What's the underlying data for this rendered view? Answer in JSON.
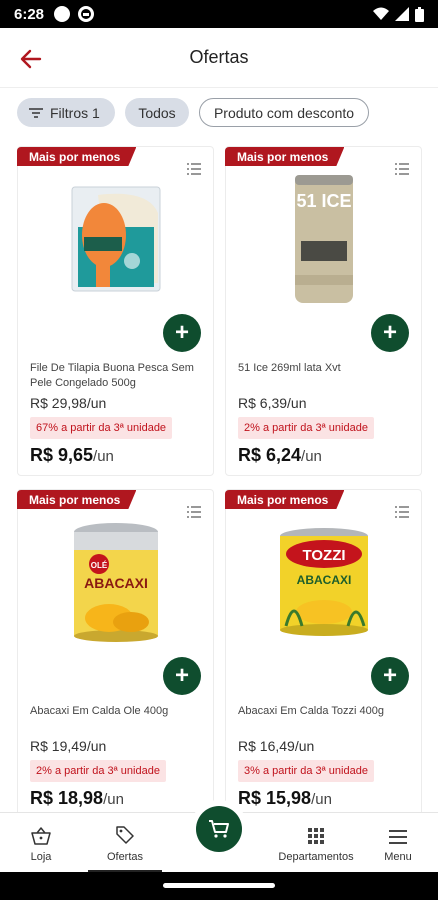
{
  "status": {
    "time": "6:28"
  },
  "header": {
    "title": "Ofertas"
  },
  "filters": {
    "filter_label": "Filtros 1",
    "all_label": "Todos",
    "discount_label": "Produto com desconto"
  },
  "products": [
    {
      "badge": "Mais por menos",
      "name": "File De Tilapia Buona Pesca Sem Pele Congelado 500g",
      "old_price": "R$ 29,98/un",
      "promo": "67% a partir da 3ª unidade",
      "price": "R$ 9,65",
      "unit": "/un"
    },
    {
      "badge": "Mais por menos",
      "name": "51 Ice 269ml lata Xvt",
      "old_price": "R$ 6,39/un",
      "promo": "2% a partir da 3ª unidade",
      "price": "R$ 6,24",
      "unit": "/un"
    },
    {
      "badge": "Mais por menos",
      "name": "Abacaxi Em Calda Ole 400g",
      "old_price": "R$ 19,49/un",
      "promo": "2% a partir da 3ª unidade",
      "price": "R$ 18,98",
      "unit": "/un"
    },
    {
      "badge": "Mais por menos",
      "name": "Abacaxi Em Calda Tozzi 400g",
      "old_price": "R$ 16,49/un",
      "promo": "3% a partir da 3ª unidade",
      "price": "R$ 15,98",
      "unit": "/un"
    }
  ],
  "product_images": {
    "tozzi_brand": "TOZZI",
    "tozzi_label": "ABACAXI",
    "ole_brand": "OLÉ",
    "ole_label": "ABACAXI",
    "can_51_text": "51 ICE"
  },
  "nav": {
    "store": "Loja",
    "offers": "Ofertas",
    "departments": "Departamentos",
    "menu": "Menu"
  },
  "colors": {
    "accent_red": "#b0171f",
    "brand_green": "#0f4d2e",
    "promo_bg": "#fbe3e4"
  }
}
